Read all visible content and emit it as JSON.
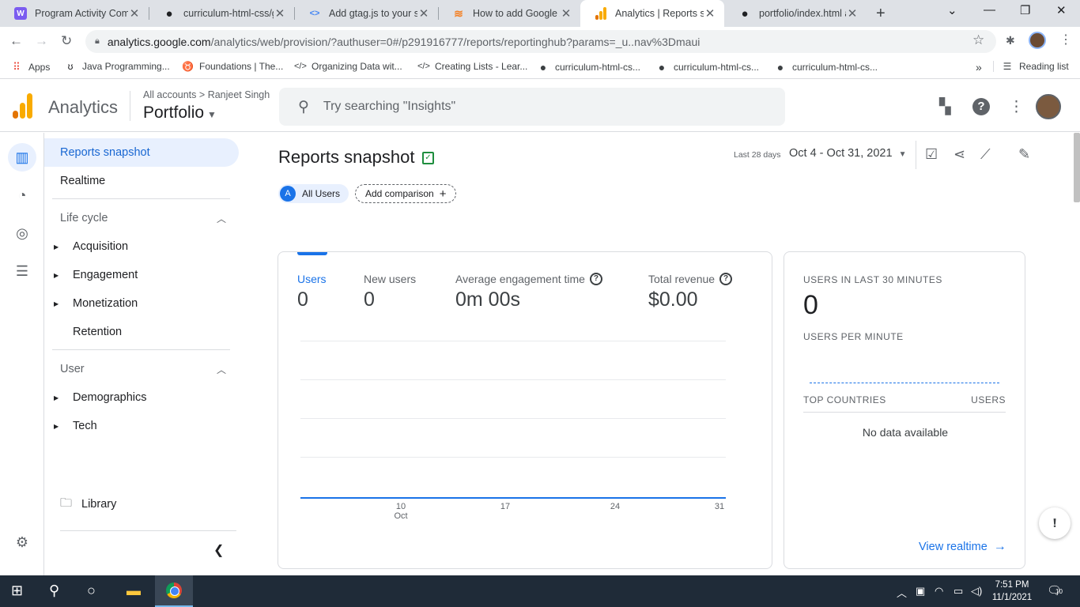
{
  "browser": {
    "tabs": [
      {
        "title": "Program Activity Com",
        "icon": "monogram-icon",
        "fav": "W",
        "favcolor": "#7b5cf0",
        "active": false
      },
      {
        "title": "curriculum-html-css/g",
        "icon": "github-icon",
        "fav": "◉",
        "favcolor": "#202124",
        "active": false
      },
      {
        "title": "Add gtag.js to your sit",
        "icon": "google-developers-icon",
        "fav": "<>",
        "favcolor": "#4285f4",
        "active": false
      },
      {
        "title": "How to add Google A",
        "icon": "stackoverflow-icon",
        "fav": "≋",
        "favcolor": "#f48024",
        "active": false
      },
      {
        "title": "Analytics | Reports sna",
        "icon": "analytics-icon",
        "fav": "▮",
        "favcolor": "#f9ab00",
        "active": true
      },
      {
        "title": "portfolio/index.html a",
        "icon": "github-icon",
        "fav": "◉",
        "favcolor": "#202124",
        "active": false
      }
    ],
    "url": {
      "host": "analytics.google.com",
      "path": "/analytics/web/provision/?authuser=0#/p291916777/reports/reportinghub?params=_u..nav%3Dmaui"
    },
    "bookmarks": [
      {
        "label": "Apps",
        "icon": "apps-grid-icon"
      },
      {
        "label": "Java Programming...",
        "icon": "java-icon"
      },
      {
        "label": "Foundations | The...",
        "icon": "odin-icon"
      },
      {
        "label": "Organizing Data wit...",
        "icon": "code-icon"
      },
      {
        "label": "Creating Lists - Lear...",
        "icon": "code-icon"
      },
      {
        "label": "curriculum-html-cs...",
        "icon": "github-icon"
      },
      {
        "label": "curriculum-html-cs...",
        "icon": "github-icon"
      },
      {
        "label": "curriculum-html-cs...",
        "icon": "github-icon"
      }
    ],
    "reading_list": "Reading list"
  },
  "header": {
    "app_name": "Analytics",
    "breadcrumb_accounts": "All accounts",
    "breadcrumb_sep": ">",
    "breadcrumb_account": "Ranjeet Singh",
    "property": "Portfolio",
    "search_placeholder": "Try searching \"Insights\""
  },
  "sidebar": {
    "items": [
      {
        "label": "Reports snapshot"
      },
      {
        "label": "Realtime"
      },
      {
        "label": "Life cycle"
      },
      {
        "label": "Acquisition"
      },
      {
        "label": "Engagement"
      },
      {
        "label": "Monetization"
      },
      {
        "label": "Retention"
      },
      {
        "label": "User"
      },
      {
        "label": "Demographics"
      },
      {
        "label": "Tech"
      }
    ],
    "library": "Library"
  },
  "main": {
    "title": "Reports snapshot",
    "date_label": "Last 28 days",
    "date_range": "Oct 4 - Oct 31, 2021",
    "comparison": {
      "chip_letter": "A",
      "chip_label": "All Users",
      "add_label": "Add comparison"
    },
    "metrics": [
      {
        "label": "Users",
        "value": "0"
      },
      {
        "label": "New users",
        "value": "0"
      },
      {
        "label": "Average engagement time",
        "value": "0m 00s"
      },
      {
        "label": "Total revenue",
        "value": "$0.00"
      }
    ],
    "xaxis": {
      "ticks": [
        "10",
        "17",
        "24",
        "31"
      ],
      "month": "Oct"
    },
    "realtime": {
      "users_label": "USERS IN LAST 30 MINUTES",
      "users_value": "0",
      "per_minute_label": "USERS PER MINUTE",
      "col_countries": "TOP COUNTRIES",
      "col_users": "USERS",
      "empty": "No data available",
      "link": "View realtime"
    }
  },
  "taskbar": {
    "time": "7:51 PM",
    "date": "11/1/2021",
    "notifications": "10"
  },
  "colors": {
    "accent": "#1a73e8",
    "active_bg": "#e8f0fe",
    "logo_orange": "#e37400",
    "logo_yellow": "#f9ab00"
  }
}
